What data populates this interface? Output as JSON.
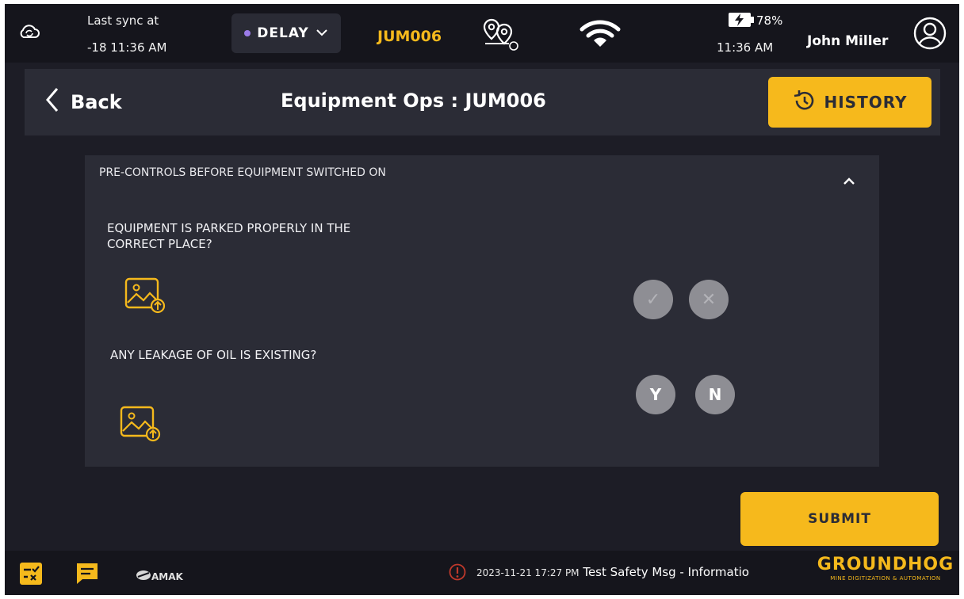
{
  "status_bar": {
    "sync_label": "Last sync at",
    "sync_time": "-18 11:36 AM",
    "status_pill": "DELAY",
    "equipment_id": "JUM006",
    "battery": "78%",
    "clock": "11:36 AM",
    "user_name": "John Miller",
    "colors": {
      "accent": "#f5b91c",
      "status_dot": "#9b7be8"
    },
    "icons": [
      "cloud-sync-icon",
      "chevron-down-icon",
      "route-pins-icon",
      "wifi-icon",
      "battery-charging-icon",
      "user-avatar-icon"
    ]
  },
  "header": {
    "back_label": "Back",
    "title": "Equipment Ops : JUM006",
    "history_label": "HISTORY"
  },
  "checklist": {
    "section_title": "PRE-CONTROLS BEFORE EQUIPMENT SWITCHED ON",
    "questions": [
      {
        "text": "EQUIPMENT IS PARKED PROPERLY IN THE CORRECT PLACE?",
        "answer_options": [
          "check",
          "x"
        ]
      },
      {
        "text": "ANY LEAKAGE OF OIL IS EXISTING?",
        "answer_options": [
          "Y",
          "N"
        ]
      }
    ],
    "check_glyph": "✓",
    "x_glyph": "✕"
  },
  "submit_label": "SUBMIT",
  "bottom_bar": {
    "logo_text": "AMAK",
    "message_time": "2023-11-21 17:27 PM",
    "message_text": "Test Safety Msg - Informatio",
    "brand_name": "GROUNDHOG",
    "brand_tagline": "MINE DIGITIZATION & AUTOMATION"
  }
}
